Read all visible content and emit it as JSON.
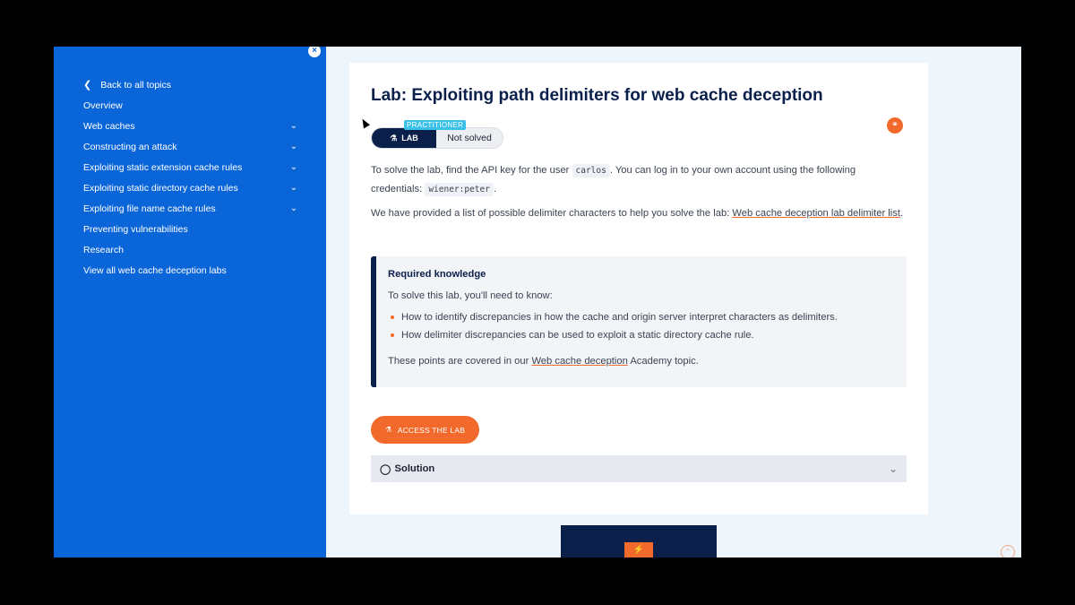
{
  "sidebar": {
    "close_icon": "×",
    "back": {
      "icon": "chevron-left-icon",
      "label": "Back to all topics"
    },
    "items": [
      {
        "label": "Overview",
        "expandable": false
      },
      {
        "label": "Web caches",
        "expandable": true
      },
      {
        "label": "Constructing an attack",
        "expandable": true
      },
      {
        "label": "Exploiting static extension cache rules",
        "expandable": true
      },
      {
        "label": "Exploiting static directory cache rules",
        "expandable": true
      },
      {
        "label": "Exploiting file name cache rules",
        "expandable": true
      },
      {
        "label": "Preventing vulnerabilities",
        "expandable": false
      },
      {
        "label": "Research",
        "expandable": false
      },
      {
        "label": "View all web cache deception labs",
        "expandable": false
      }
    ],
    "bg_color": "#0a65d8"
  },
  "lab": {
    "title": "Lab: Exploiting path delimiters for web cache deception",
    "level": "PRACTITIONER",
    "badge_label": "LAB",
    "status": "Not solved",
    "p1_a": "To solve the lab, find the API key for the user ",
    "p1_code_user": "carlos",
    "p1_b": ". You can log in to your own account using the following credentials: ",
    "p1_code_creds": "wiener:peter",
    "p1_c": ".",
    "p2_a": "We have provided a list of possible delimiter characters to help you solve the lab: ",
    "p2_link": "Web cache deception lab delimiter list",
    "p2_c": "."
  },
  "required_knowledge": {
    "title": "Required knowledge",
    "intro": "To solve this lab, you'll need to know:",
    "bullets": [
      "How to identify discrepancies in how the cache and origin server interpret characters as delimiters.",
      "How delimiter discrepancies can be used to exploit a static directory cache rule."
    ],
    "foot_a": "These points are covered in our ",
    "foot_link": "Web cache deception",
    "foot_c": " Academy topic."
  },
  "actions": {
    "access_label": "ACCESS THE LAB",
    "solution_label": "Solution"
  },
  "colors": {
    "accent": "#f26a2b",
    "navy": "#0b1f4b",
    "practitioner": "#3ac0e8"
  }
}
